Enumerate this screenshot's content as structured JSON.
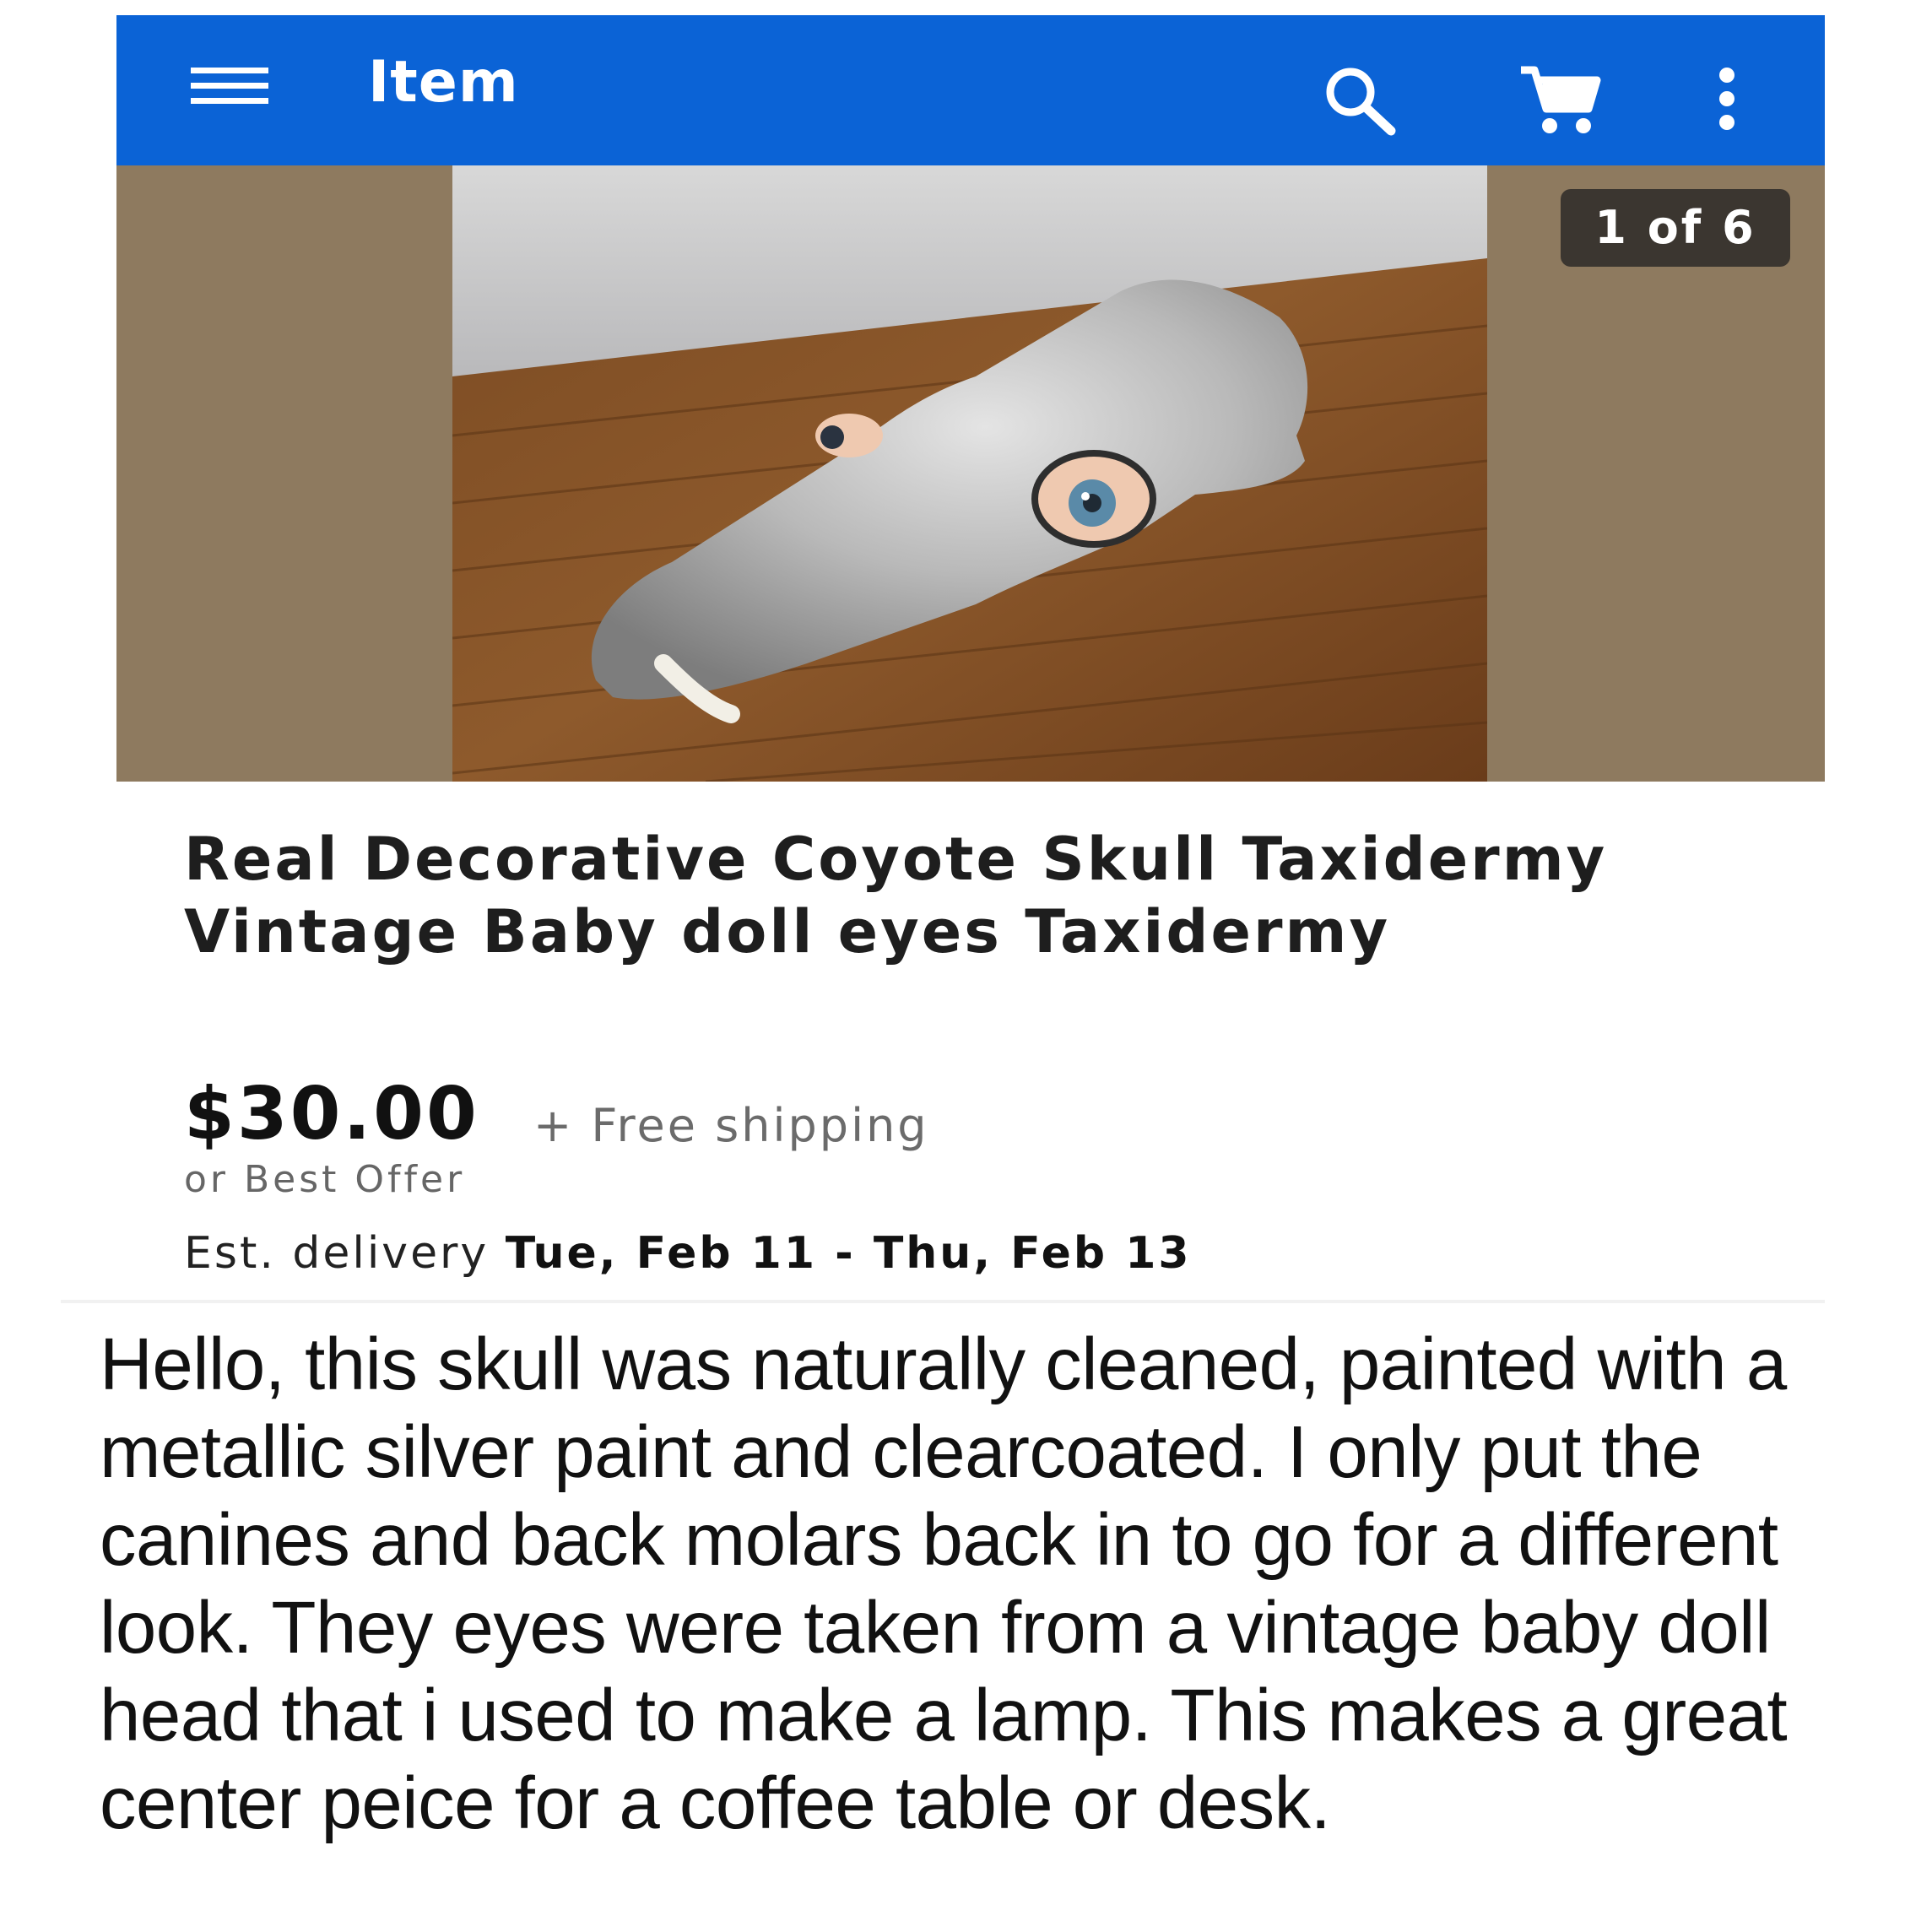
{
  "app_bar": {
    "title": "Item",
    "icons": [
      "menu-icon",
      "search-icon",
      "cart-icon",
      "more-vertical-icon"
    ],
    "color": "#0b63d6"
  },
  "gallery": {
    "counter": "1 of 6"
  },
  "listing": {
    "title": "Real Decorative Coyote Skull Taxidermy Vintage Baby doll eyes Taxidermy",
    "price": "$30.00",
    "shipping": "+ Free shipping",
    "best_offer": "or Best Offer",
    "delivery_label": "Est. delivery",
    "delivery_dates": "Tue, Feb 11 - Thu, Feb 13"
  },
  "description": "Hello, this skull was naturally cleaned, painted with a metallic silver paint and clearcoated. I only put the canines and back molars back in to go for a different look. They eyes were taken from a vintage baby doll head that i used to make a lamp. This makes a great center peice for a coffee table or desk."
}
